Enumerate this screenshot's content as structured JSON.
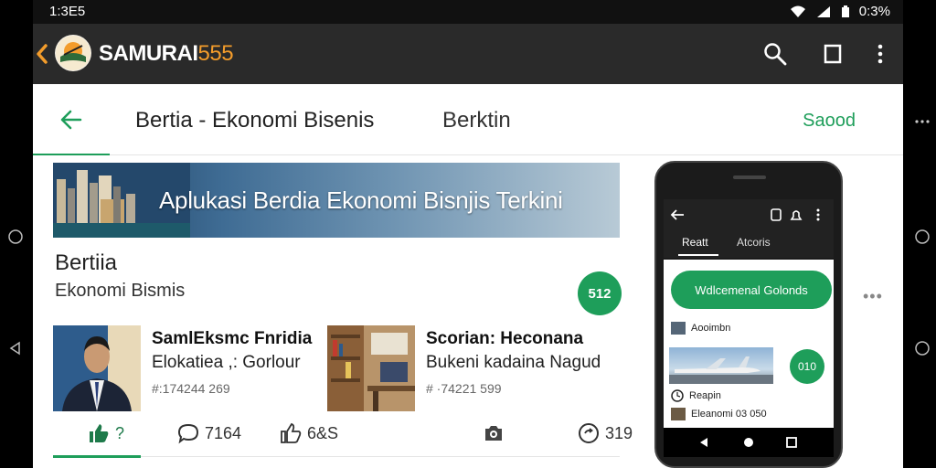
{
  "status_bar": {
    "time": "1:3E5",
    "battery": "0:3%"
  },
  "app_bar": {
    "brand_name": "SAMURAI",
    "brand_number": "555",
    "icons": [
      "back-chevron-icon",
      "search-icon",
      "square-icon",
      "more-vert-icon"
    ]
  },
  "top_nav": {
    "title": "Bertia - Ekonomi Bisenis",
    "tab": "Berktin",
    "action": "Saood"
  },
  "banner": {
    "headline": "Aplukasi Berdia Ekonomi Bisnjis Terkini"
  },
  "section": {
    "title": "Bertiia",
    "subtitle": "Ekonomi Bismis",
    "badge": "512"
  },
  "cards": [
    {
      "title": "SamlEksmc Fnridia",
      "subtitle": "Elokatiea ,: Gorlour",
      "meta": "#:174244 269"
    },
    {
      "title": "Scorian: Heconana",
      "subtitle": "Bukeni kadaina Nagud",
      "meta": "# ·74221 599"
    }
  ],
  "actions": [
    {
      "icon": "thumbs-up-icon",
      "label": "?"
    },
    {
      "icon": "comment-icon",
      "label": "7164"
    },
    {
      "icon": "like-icon",
      "label": "6&S"
    },
    {
      "icon": "camera-icon",
      "label": ""
    },
    {
      "icon": "share-icon",
      "label": "319"
    }
  ],
  "phone": {
    "tab_active": "Reatt",
    "tab_other": "Atcoris",
    "button": "Wdlcemenal Golonds",
    "row1": "Aooimbn",
    "row2": "Reapin",
    "row3": "Eleanomi 03 050",
    "badge": "010"
  },
  "colors": {
    "accent": "#1e9e5a",
    "brand_number": "#f39c2b",
    "appbar": "#2a2a2a"
  }
}
